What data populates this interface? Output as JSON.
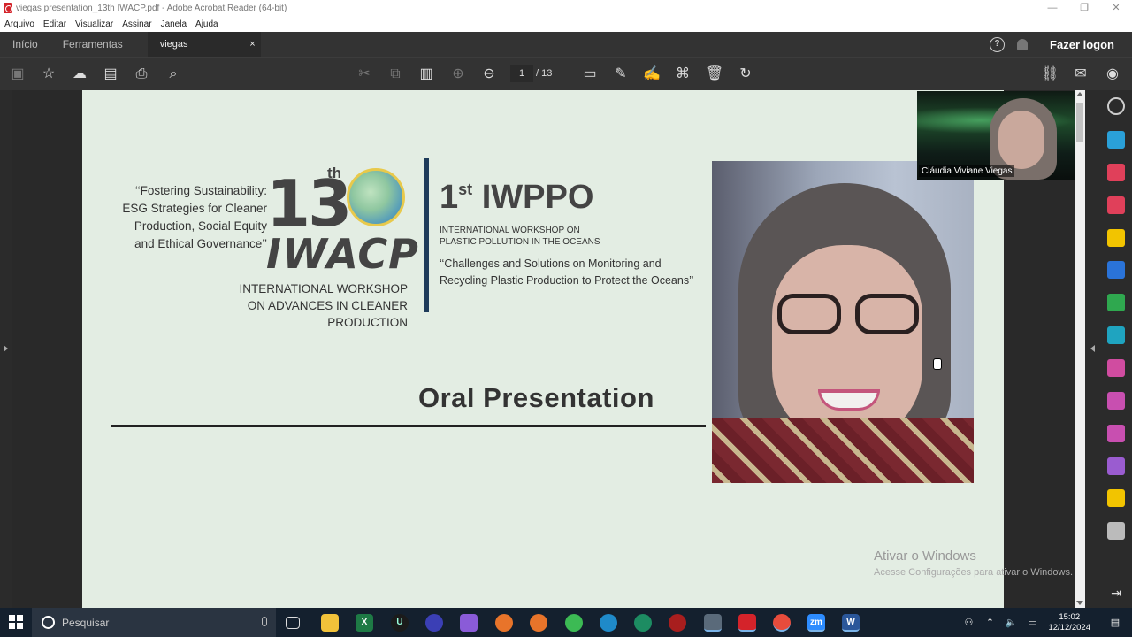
{
  "window": {
    "title": "viegas presentation_13th IWACP.pdf - Adobe Acrobat Reader (64-bit)",
    "minimize": "—",
    "maximize": "❐",
    "close": "✕"
  },
  "menu": [
    "Arquivo",
    "Editar",
    "Visualizar",
    "Assinar",
    "Janela",
    "Ajuda"
  ],
  "tabs": {
    "home": "Início",
    "tools": "Ferramentas",
    "doc": "viegas presentation...",
    "doc_close": "×"
  },
  "header": {
    "help": "?",
    "login": "Fazer logon"
  },
  "toolbar": {
    "page_current": "1",
    "page_total": "/ 13"
  },
  "slide": {
    "quote_left": "‘‘Fostering Sustainability: ESG Strategies for Cleaner Production, Social Equity and Ethical Governance’’",
    "num": "13",
    "th": "th",
    "iwacp": "IWACP",
    "iwacp_sub1": "INTERNATIONAL WORKSHOP",
    "iwacp_sub2": "ON ADVANCES IN CLEANER PRODUCTION",
    "iwppo_num": "1",
    "iwppo_sup": "st",
    "iwppo": "IWPPO",
    "iwppo_sub1": "INTERNATIONAL WORKSHOP ON",
    "iwppo_sub2": "PLASTIC POLLUTION IN THE OCEANS",
    "iwppo_quote1": "‘‘Challenges and Solutions on Monitoring and",
    "iwppo_quote2": "Recycling Plastic Production to Protect the Oceans’’",
    "oral": "Oral Presentation"
  },
  "video": {
    "participant": "Cláudia Viviane Viegas"
  },
  "watermark": {
    "line1": "Ativar o Windows",
    "line2": "Acesse Configurações para ativar o Windows."
  },
  "taskbar": {
    "search_placeholder": "Pesquisar",
    "time": "15:02",
    "date": "12/12/2024"
  },
  "colors": {
    "slide_bg": "#e3ede3",
    "divider": "#1e3b5a",
    "taskbar": "#14202e"
  }
}
